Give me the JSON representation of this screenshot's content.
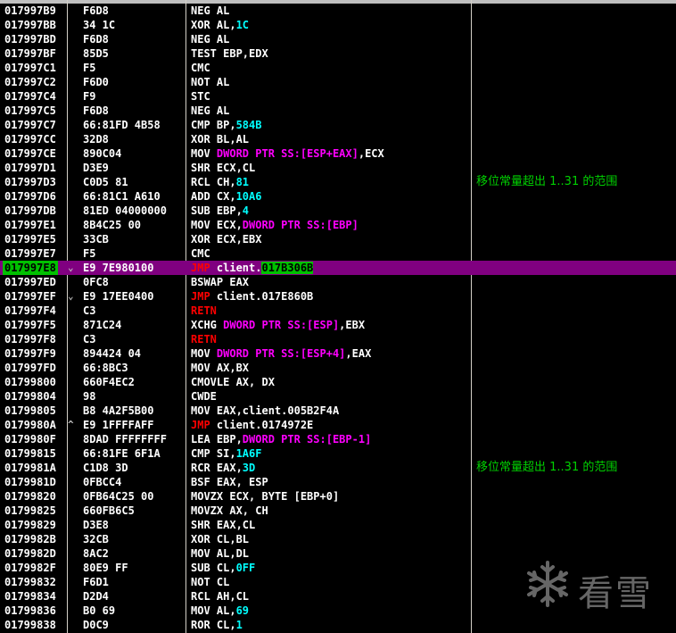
{
  "window": {
    "title": ""
  },
  "watermark": {
    "text": "看雪"
  },
  "rows": [
    {
      "addr": "017997B9",
      "arrow": "",
      "hex": "F6D8",
      "parts": [
        [
          "plain",
          "NEG AL"
        ]
      ],
      "comment": ""
    },
    {
      "addr": "017997BB",
      "arrow": "",
      "hex": "34 1C",
      "parts": [
        [
          "plain",
          "XOR AL,"
        ],
        [
          "num",
          "1C"
        ]
      ],
      "comment": ""
    },
    {
      "addr": "017997BD",
      "arrow": "",
      "hex": "F6D8",
      "parts": [
        [
          "plain",
          "NEG AL"
        ]
      ],
      "comment": ""
    },
    {
      "addr": "017997BF",
      "arrow": "",
      "hex": "85D5",
      "parts": [
        [
          "plain",
          "TEST EBP,EDX"
        ]
      ],
      "comment": ""
    },
    {
      "addr": "017997C1",
      "arrow": "",
      "hex": "F5",
      "parts": [
        [
          "plain",
          "CMC"
        ]
      ],
      "comment": ""
    },
    {
      "addr": "017997C2",
      "arrow": "",
      "hex": "F6D0",
      "parts": [
        [
          "plain",
          "NOT AL"
        ]
      ],
      "comment": ""
    },
    {
      "addr": "017997C4",
      "arrow": "",
      "hex": "F9",
      "parts": [
        [
          "plain",
          "STC"
        ]
      ],
      "comment": ""
    },
    {
      "addr": "017997C5",
      "arrow": "",
      "hex": "F6D8",
      "parts": [
        [
          "plain",
          "NEG AL"
        ]
      ],
      "comment": ""
    },
    {
      "addr": "017997C7",
      "arrow": "",
      "hex": "66:81FD 4B58",
      "parts": [
        [
          "plain",
          "CMP BP,"
        ],
        [
          "num",
          "584B"
        ]
      ],
      "comment": ""
    },
    {
      "addr": "017997CC",
      "arrow": "",
      "hex": "32D8",
      "parts": [
        [
          "plain",
          "XOR BL,AL"
        ]
      ],
      "comment": ""
    },
    {
      "addr": "017997CE",
      "arrow": "",
      "hex": "890C04",
      "parts": [
        [
          "plain",
          "MOV "
        ],
        [
          "kw",
          "DWORD PTR SS:[ESP+EAX]"
        ],
        [
          "plain",
          ",ECX"
        ]
      ],
      "comment": ""
    },
    {
      "addr": "017997D1",
      "arrow": "",
      "hex": "D3E9",
      "parts": [
        [
          "plain",
          "SHR ECX,CL"
        ]
      ],
      "comment": ""
    },
    {
      "addr": "017997D3",
      "arrow": "",
      "hex": "C0D5 81",
      "parts": [
        [
          "plain",
          "RCL CH,"
        ],
        [
          "num",
          "81"
        ]
      ],
      "comment": "移位常量超出 1..31 的范围"
    },
    {
      "addr": "017997D6",
      "arrow": "",
      "hex": "66:81C1 A610",
      "parts": [
        [
          "plain",
          "ADD CX,"
        ],
        [
          "num",
          "10A6"
        ]
      ],
      "comment": ""
    },
    {
      "addr": "017997DB",
      "arrow": "",
      "hex": "81ED 04000000",
      "parts": [
        [
          "plain",
          "SUB EBP,"
        ],
        [
          "num",
          "4"
        ]
      ],
      "comment": ""
    },
    {
      "addr": "017997E1",
      "arrow": "",
      "hex": "8B4C25 00",
      "parts": [
        [
          "plain",
          "MOV ECX,"
        ],
        [
          "kw",
          "DWORD PTR SS:[EBP]"
        ]
      ],
      "comment": ""
    },
    {
      "addr": "017997E5",
      "arrow": "",
      "hex": "33CB",
      "parts": [
        [
          "plain",
          "XOR ECX,EBX"
        ]
      ],
      "comment": ""
    },
    {
      "addr": "017997E7",
      "arrow": "",
      "hex": "F5",
      "parts": [
        [
          "plain",
          "CMC"
        ]
      ],
      "comment": ""
    },
    {
      "addr": "017997E8",
      "arrow": "⌄",
      "hex": "E9 7E980100",
      "parts": [
        [
          "mnem-jmp",
          "JMP "
        ],
        [
          "addrop",
          "client."
        ],
        [
          "hilite",
          "017B306B"
        ]
      ],
      "comment": "",
      "selected": true
    },
    {
      "addr": "017997ED",
      "arrow": "",
      "hex": "0FC8",
      "parts": [
        [
          "plain",
          "BSWAP EAX"
        ]
      ],
      "comment": ""
    },
    {
      "addr": "017997EF",
      "arrow": "⌄",
      "hex": "E9 17EE0400",
      "parts": [
        [
          "mnem-jmp",
          "JMP "
        ],
        [
          "plain",
          "client.017E860B"
        ]
      ],
      "comment": ""
    },
    {
      "addr": "017997F4",
      "arrow": "",
      "hex": "C3",
      "parts": [
        [
          "mnem-jmp",
          "RETN"
        ]
      ],
      "comment": ""
    },
    {
      "addr": "017997F5",
      "arrow": "",
      "hex": "871C24",
      "parts": [
        [
          "plain",
          "XCHG "
        ],
        [
          "kw",
          "DWORD PTR SS:[ESP]"
        ],
        [
          "plain",
          ",EBX"
        ]
      ],
      "comment": ""
    },
    {
      "addr": "017997F8",
      "arrow": "",
      "hex": "C3",
      "parts": [
        [
          "mnem-jmp",
          "RETN"
        ]
      ],
      "comment": ""
    },
    {
      "addr": "017997F9",
      "arrow": "",
      "hex": "894424 04",
      "parts": [
        [
          "plain",
          "MOV "
        ],
        [
          "kw",
          "DWORD PTR SS:[ESP+4]"
        ],
        [
          "plain",
          ",EAX"
        ]
      ],
      "comment": ""
    },
    {
      "addr": "017997FD",
      "arrow": "",
      "hex": "66:8BC3",
      "parts": [
        [
          "plain",
          "MOV AX,BX"
        ]
      ],
      "comment": ""
    },
    {
      "addr": "01799800",
      "arrow": "",
      "hex": "660F4EC2",
      "parts": [
        [
          "plain",
          "CMOVLE AX, DX"
        ]
      ],
      "comment": ""
    },
    {
      "addr": "01799804",
      "arrow": "",
      "hex": "98",
      "parts": [
        [
          "plain",
          "CWDE"
        ]
      ],
      "comment": ""
    },
    {
      "addr": "01799805",
      "arrow": "",
      "hex": "B8 4A2F5B00",
      "parts": [
        [
          "plain",
          "MOV EAX,client.005B2F4A"
        ]
      ],
      "comment": ""
    },
    {
      "addr": "0179980A",
      "arrow": "^",
      "hex": "E9 1FFFFAFF",
      "parts": [
        [
          "mnem-jmp",
          "JMP "
        ],
        [
          "plain",
          "client.0174972E"
        ]
      ],
      "comment": ""
    },
    {
      "addr": "0179980F",
      "arrow": "",
      "hex": "8DAD FFFFFFFF",
      "parts": [
        [
          "plain",
          "LEA EBP,"
        ],
        [
          "kw",
          "DWORD PTR SS:[EBP-1]"
        ]
      ],
      "comment": ""
    },
    {
      "addr": "01799815",
      "arrow": "",
      "hex": "66:81FE 6F1A",
      "parts": [
        [
          "plain",
          "CMP SI,"
        ],
        [
          "num",
          "1A6F"
        ]
      ],
      "comment": ""
    },
    {
      "addr": "0179981A",
      "arrow": "",
      "hex": "C1D8 3D",
      "parts": [
        [
          "plain",
          "RCR EAX,"
        ],
        [
          "num",
          "3D"
        ]
      ],
      "comment": "移位常量超出 1..31 的范围"
    },
    {
      "addr": "0179981D",
      "arrow": "",
      "hex": "0FBCC4",
      "parts": [
        [
          "plain",
          "BSF EAX, ESP"
        ]
      ],
      "comment": ""
    },
    {
      "addr": "01799820",
      "arrow": "",
      "hex": "0FB64C25 00",
      "parts": [
        [
          "plain",
          "MOVZX ECX, BYTE [EBP+0]"
        ]
      ],
      "comment": ""
    },
    {
      "addr": "01799825",
      "arrow": "",
      "hex": "660FB6C5",
      "parts": [
        [
          "plain",
          "MOVZX AX, CH"
        ]
      ],
      "comment": ""
    },
    {
      "addr": "01799829",
      "arrow": "",
      "hex": "D3E8",
      "parts": [
        [
          "plain",
          "SHR EAX,CL"
        ]
      ],
      "comment": ""
    },
    {
      "addr": "0179982B",
      "arrow": "",
      "hex": "32CB",
      "parts": [
        [
          "plain",
          "XOR CL,BL"
        ]
      ],
      "comment": ""
    },
    {
      "addr": "0179982D",
      "arrow": "",
      "hex": "8AC2",
      "parts": [
        [
          "plain",
          "MOV AL,DL"
        ]
      ],
      "comment": ""
    },
    {
      "addr": "0179982F",
      "arrow": "",
      "hex": "80E9 FF",
      "parts": [
        [
          "plain",
          "SUB CL,"
        ],
        [
          "num",
          "0FF"
        ]
      ],
      "comment": ""
    },
    {
      "addr": "01799832",
      "arrow": "",
      "hex": "F6D1",
      "parts": [
        [
          "plain",
          "NOT CL"
        ]
      ],
      "comment": ""
    },
    {
      "addr": "01799834",
      "arrow": "",
      "hex": "D2D4",
      "parts": [
        [
          "plain",
          "RCL AH,CL"
        ]
      ],
      "comment": ""
    },
    {
      "addr": "01799836",
      "arrow": "",
      "hex": "B0 69",
      "parts": [
        [
          "plain",
          "MOV AL,"
        ],
        [
          "num",
          "69"
        ]
      ],
      "comment": ""
    },
    {
      "addr": "01799838",
      "arrow": "",
      "hex": "D0C9",
      "parts": [
        [
          "plain",
          "ROR CL,"
        ],
        [
          "num",
          "1"
        ]
      ],
      "comment": ""
    }
  ]
}
